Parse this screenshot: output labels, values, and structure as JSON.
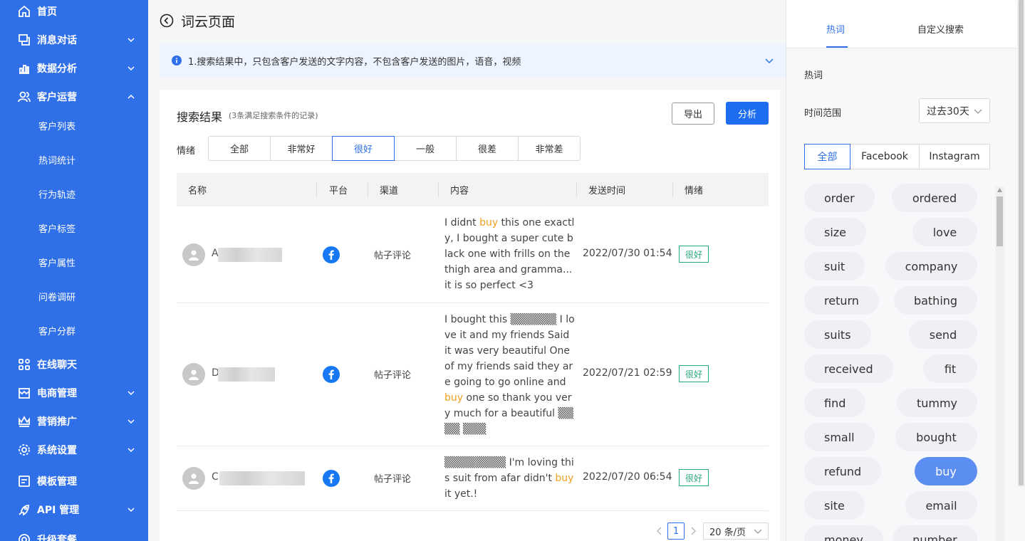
{
  "sidebar": {
    "items": [
      {
        "label": "首页",
        "icon": "home-icon"
      },
      {
        "label": "消息对话",
        "icon": "message-icon"
      },
      {
        "label": "数据分析",
        "icon": "chart-icon"
      },
      {
        "label": "客户运营",
        "icon": "users-icon"
      },
      {
        "label": "在线聊天",
        "icon": "grid-icon"
      },
      {
        "label": "电商管理",
        "icon": "shop-icon"
      },
      {
        "label": "营销推广",
        "icon": "crown-icon"
      },
      {
        "label": "系统设置",
        "icon": "gear-icon"
      },
      {
        "label": "模板管理",
        "icon": "template-icon"
      },
      {
        "label": "API 管理",
        "icon": "rocket-icon"
      },
      {
        "label": "升级套餐",
        "icon": "package-icon"
      }
    ],
    "subitems": [
      "客户列表",
      "热词统计",
      "行为轨迹",
      "客户标签",
      "客户属性",
      "问卷调研",
      "客户分群"
    ]
  },
  "header": {
    "title": "词云页面"
  },
  "notice": {
    "text": "1.搜索结果中，只包含客户发送的文字内容，不包含客户发送的图片，语音，视频"
  },
  "results": {
    "title": "搜索结果",
    "subtitle": "(3条满足搜索条件的记录)",
    "export_label": "导出",
    "analyze_label": "分析",
    "mood_label": "情绪",
    "mood_options": [
      "全部",
      "非常好",
      "很好",
      "一般",
      "很差",
      "非常差"
    ],
    "mood_selected": "很好",
    "columns": [
      "名称",
      "平台",
      "渠道",
      "内容",
      "发送时间",
      "情绪"
    ],
    "rows": [
      {
        "initial": "A",
        "channel": "帖子评论",
        "content_before": "I didnt ",
        "content_hl": "buy",
        "content_after": " this one exactly, I bought a super cute black one with frills on the thigh area and gramma... it is so perfect <3",
        "time": "2022/07/30 01:54",
        "mood": "很好"
      },
      {
        "initial": "D",
        "channel": "帖子评论",
        "content_before": "I bought this ▒▒▒▒▒▒ I love it and my friends Said it was very beautiful One of my friends said they are going to go online and ",
        "content_hl": "buy",
        "content_after": " one so thank you very much for a beautiful ▒▒▒▒ ▒▒▒",
        "time": "2022/07/21 02:59",
        "mood": "很好"
      },
      {
        "initial": "C",
        "channel": "帖子评论",
        "content_before": "▒▒▒▒▒▒▒▒ I'm loving this suit from afar didn't ",
        "content_hl": "buy",
        "content_after": " it yet.!",
        "time": "2022/07/20 06:54",
        "mood": "很好"
      }
    ],
    "pagination": {
      "page": "1",
      "page_size": "20 条/页"
    }
  },
  "right_panel": {
    "tabs": [
      "热词",
      "自定义搜索"
    ],
    "active_tab": "热词",
    "section_title": "热词",
    "range_label": "时间范围",
    "range_value": "过去30天",
    "platforms": [
      "全部",
      "Facebook",
      "Instagram"
    ],
    "active_platform": "全部",
    "words": [
      [
        "order",
        "ordered"
      ],
      [
        "size",
        "love"
      ],
      [
        "suit",
        "company"
      ],
      [
        "return",
        "bathing"
      ],
      [
        "suits",
        "send"
      ],
      [
        "received",
        "fit"
      ],
      [
        "find",
        "tummy"
      ],
      [
        "small",
        "bought"
      ],
      [
        "refund",
        "buy"
      ],
      [
        "site",
        "email"
      ],
      [
        "money",
        "number"
      ]
    ],
    "active_word": "buy"
  },
  "colors": {
    "accent": "#2f6fe8",
    "sidebar": "#2f6fe8",
    "highlight": "#f0a020",
    "mood_tag": "#29a87a"
  }
}
